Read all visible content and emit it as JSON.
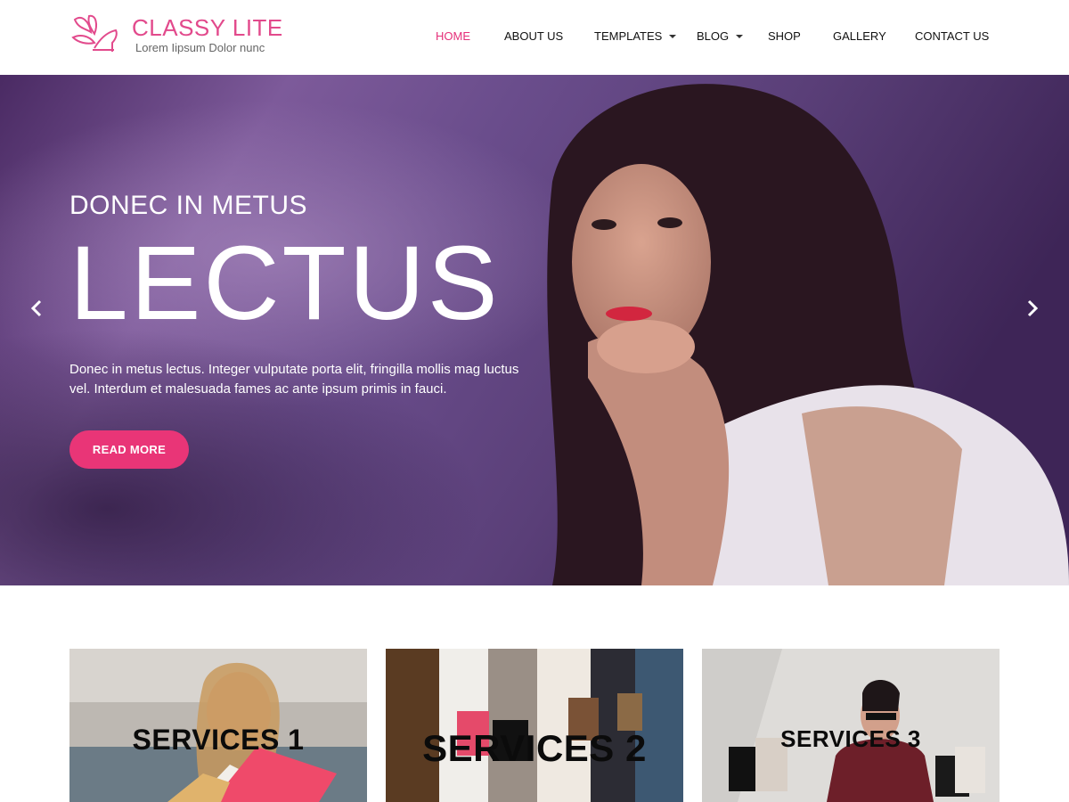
{
  "site": {
    "title": "CLASSY LITE",
    "tagline": "Lorem Iipsum Dolor nunc",
    "accent_color": "#e93577",
    "logo_icon": "butterfly-heel-logo-icon"
  },
  "nav": {
    "items": [
      {
        "label": "HOME",
        "active": true,
        "has_dropdown": false
      },
      {
        "label": "ABOUT US",
        "active": false,
        "has_dropdown": false
      },
      {
        "label": "TEMPLATES",
        "active": false,
        "has_dropdown": true
      },
      {
        "label": "BLOG",
        "active": false,
        "has_dropdown": true
      },
      {
        "label": "SHOP",
        "active": false,
        "has_dropdown": false
      },
      {
        "label": "GALLERY",
        "active": false,
        "has_dropdown": false
      },
      {
        "label": "CONTACT US",
        "active": false,
        "has_dropdown": false
      }
    ]
  },
  "hero": {
    "eyebrow": "DONEC IN METUS",
    "title": "LECTUS",
    "description": "Donec in metus lectus. Integer vulputate porta elit, fringilla mollis mag luctus vel. Interdum et malesuada fames ac ante ipsum primis in fauci.",
    "button_label": "READ MORE",
    "prev_icon": "chevron-left-icon",
    "next_icon": "chevron-right-icon"
  },
  "services": [
    {
      "title": "SERVICES 1"
    },
    {
      "title": "SERVICES 2"
    },
    {
      "title": "SERVICES 3"
    }
  ]
}
